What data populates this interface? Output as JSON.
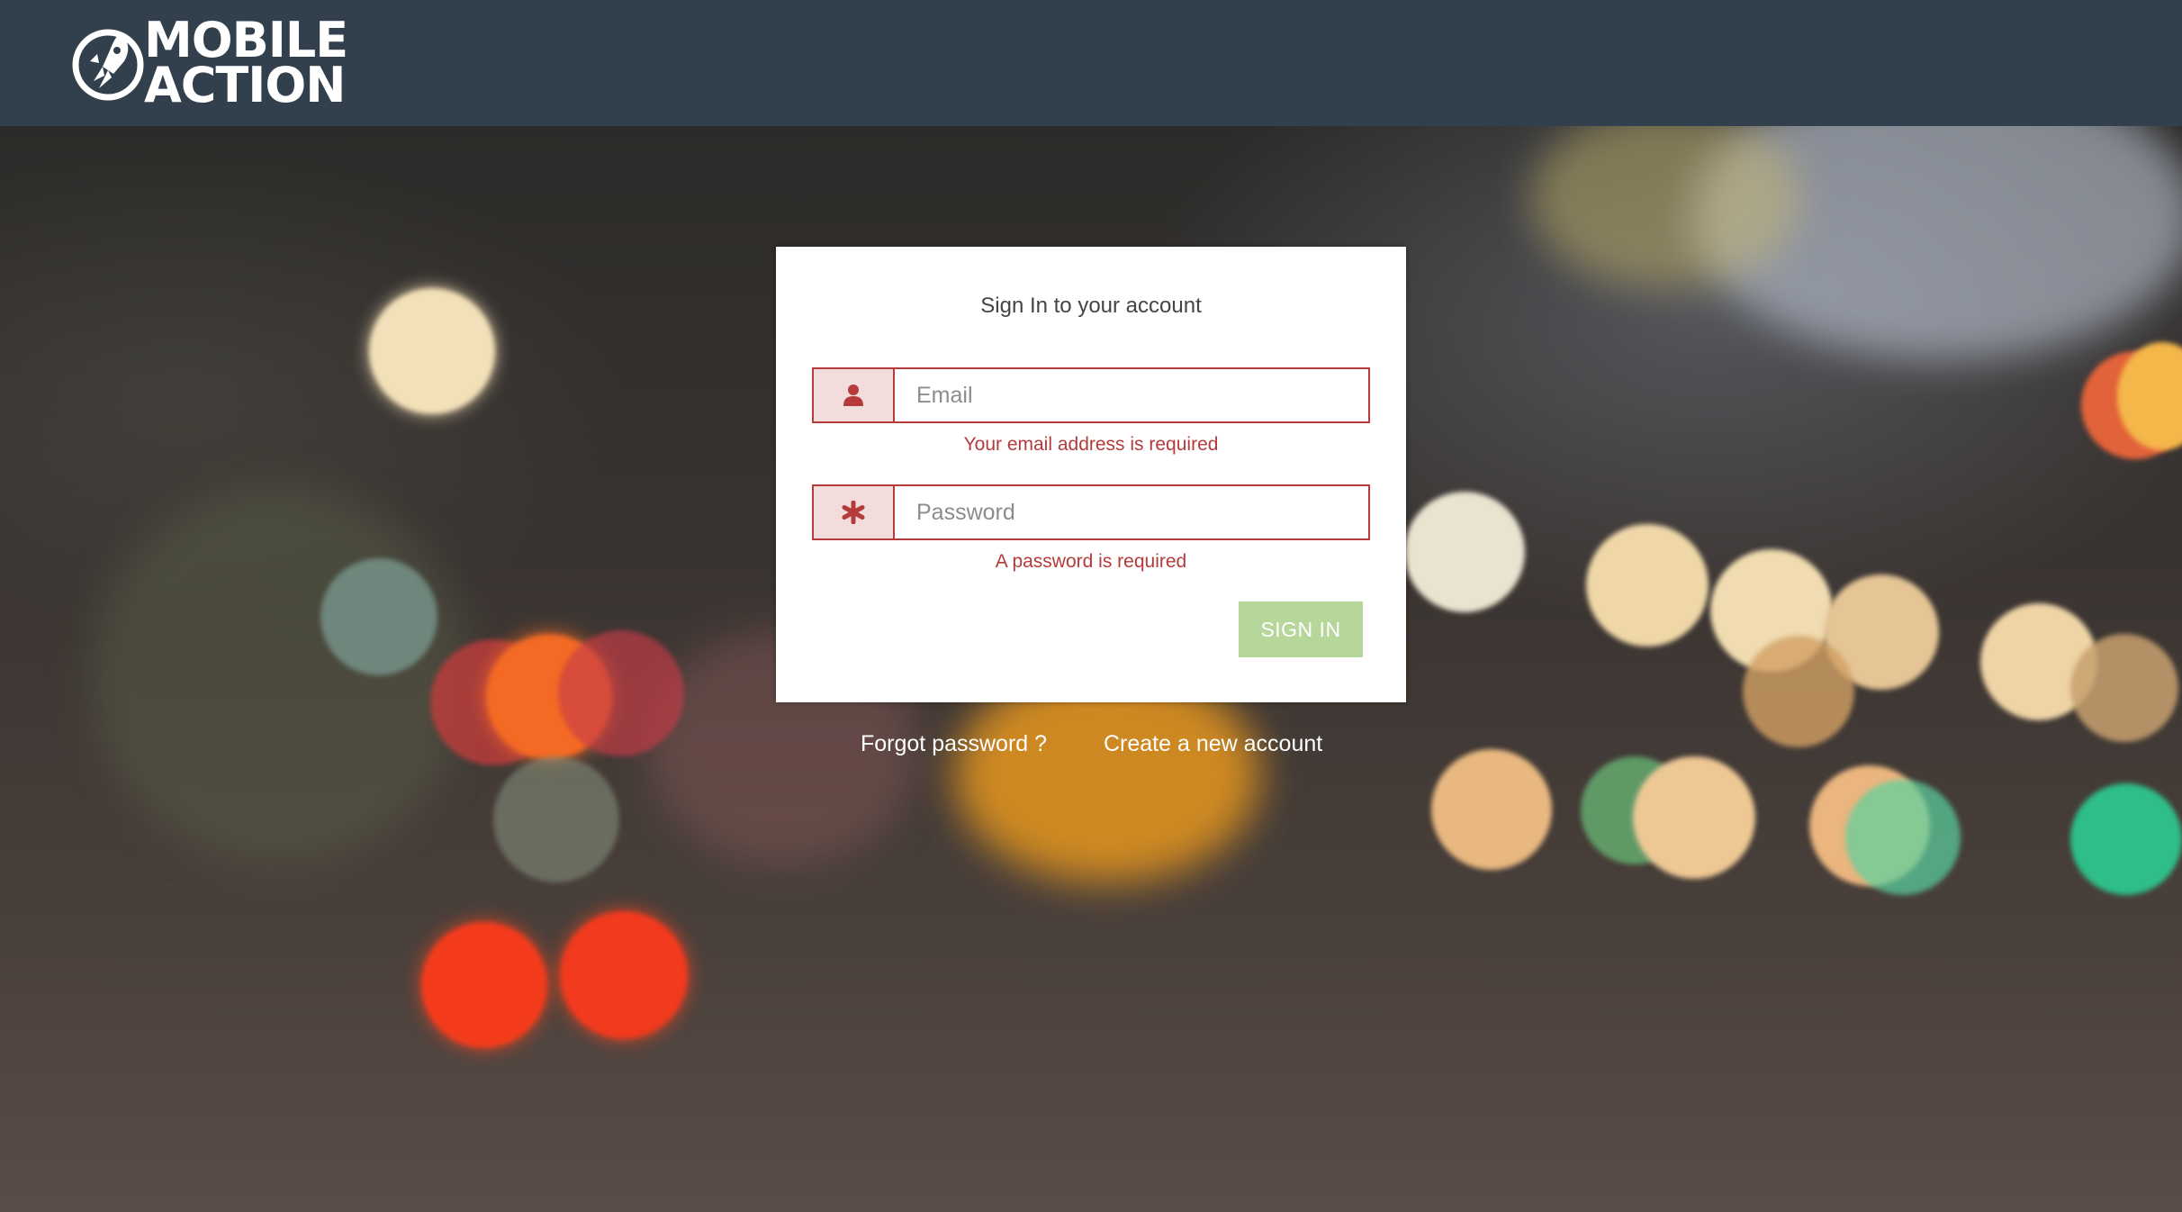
{
  "header": {
    "logo_line1": "MOBILE",
    "logo_line2": "ACTION",
    "logo_icon": "rocket-icon"
  },
  "signin": {
    "title": "Sign In to your account",
    "email": {
      "icon": "user-icon",
      "placeholder": "Email",
      "value": "",
      "error": "Your email address is required"
    },
    "password": {
      "icon": "asterisk-icon",
      "placeholder": "Password",
      "value": "",
      "error": "A password is required"
    },
    "submit_label": "SIGN IN"
  },
  "links": {
    "forgot": "Forgot password ?",
    "create": "Create a new account"
  },
  "colors": {
    "header_bg": "#323f4c",
    "error": "#b53b3b",
    "addon_bg": "#f2dcdc",
    "button_bg": "#b7d69a"
  }
}
